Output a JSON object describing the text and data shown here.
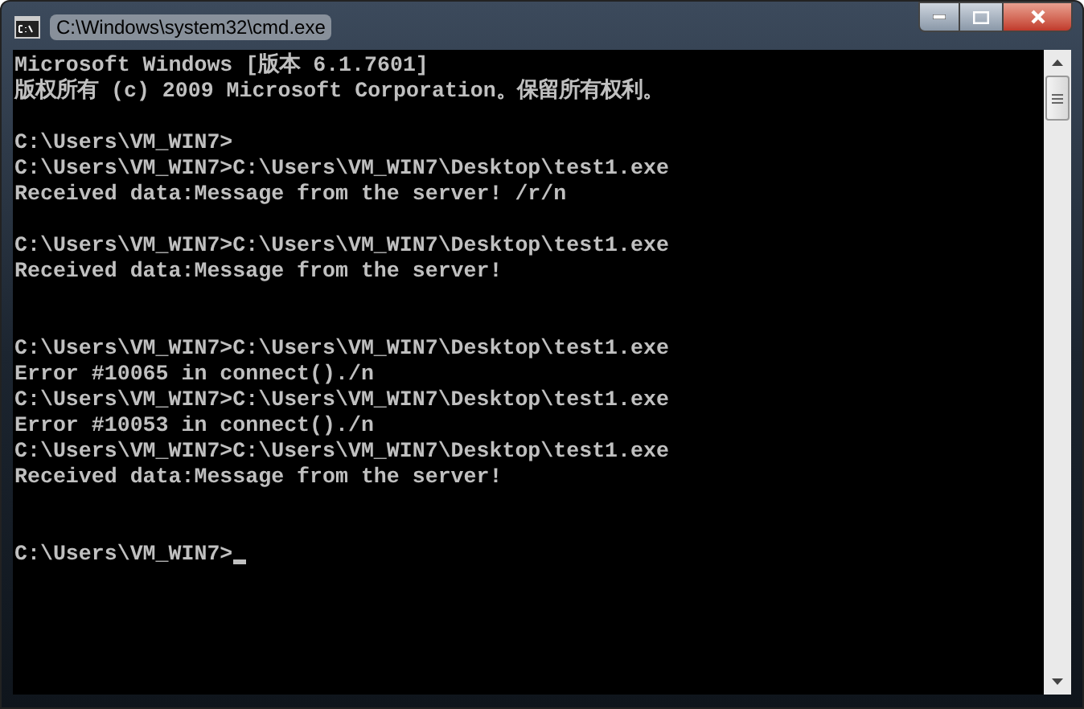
{
  "window": {
    "title": "C:\\Windows\\system32\\cmd.exe"
  },
  "console": {
    "lines": [
      {
        "kind": "text",
        "text": "Microsoft Windows [版本 6.1.7601]"
      },
      {
        "kind": "text",
        "text": "版权所有 (c) 2009 Microsoft Corporation。保留所有权利。"
      },
      {
        "kind": "blank"
      },
      {
        "kind": "text",
        "text": "C:\\Users\\VM_WIN7>"
      },
      {
        "kind": "text",
        "text": "C:\\Users\\VM_WIN7>C:\\Users\\VM_WIN7\\Desktop\\test1.exe"
      },
      {
        "kind": "text",
        "text": "Received data:Message from the server! /r/n"
      },
      {
        "kind": "blank"
      },
      {
        "kind": "text",
        "text": "C:\\Users\\VM_WIN7>C:\\Users\\VM_WIN7\\Desktop\\test1.exe"
      },
      {
        "kind": "text",
        "text": "Received data:Message from the server!"
      },
      {
        "kind": "blank"
      },
      {
        "kind": "blank"
      },
      {
        "kind": "text",
        "text": "C:\\Users\\VM_WIN7>C:\\Users\\VM_WIN7\\Desktop\\test1.exe"
      },
      {
        "kind": "text",
        "text": "Error #10065 in connect()./n"
      },
      {
        "kind": "text",
        "text": "C:\\Users\\VM_WIN7>C:\\Users\\VM_WIN7\\Desktop\\test1.exe"
      },
      {
        "kind": "text",
        "text": "Error #10053 in connect()./n"
      },
      {
        "kind": "text",
        "text": "C:\\Users\\VM_WIN7>C:\\Users\\VM_WIN7\\Desktop\\test1.exe"
      },
      {
        "kind": "text",
        "text": "Received data:Message from the server!"
      },
      {
        "kind": "blank"
      },
      {
        "kind": "blank"
      },
      {
        "kind": "prompt",
        "text": "C:\\Users\\VM_WIN7>"
      }
    ]
  }
}
